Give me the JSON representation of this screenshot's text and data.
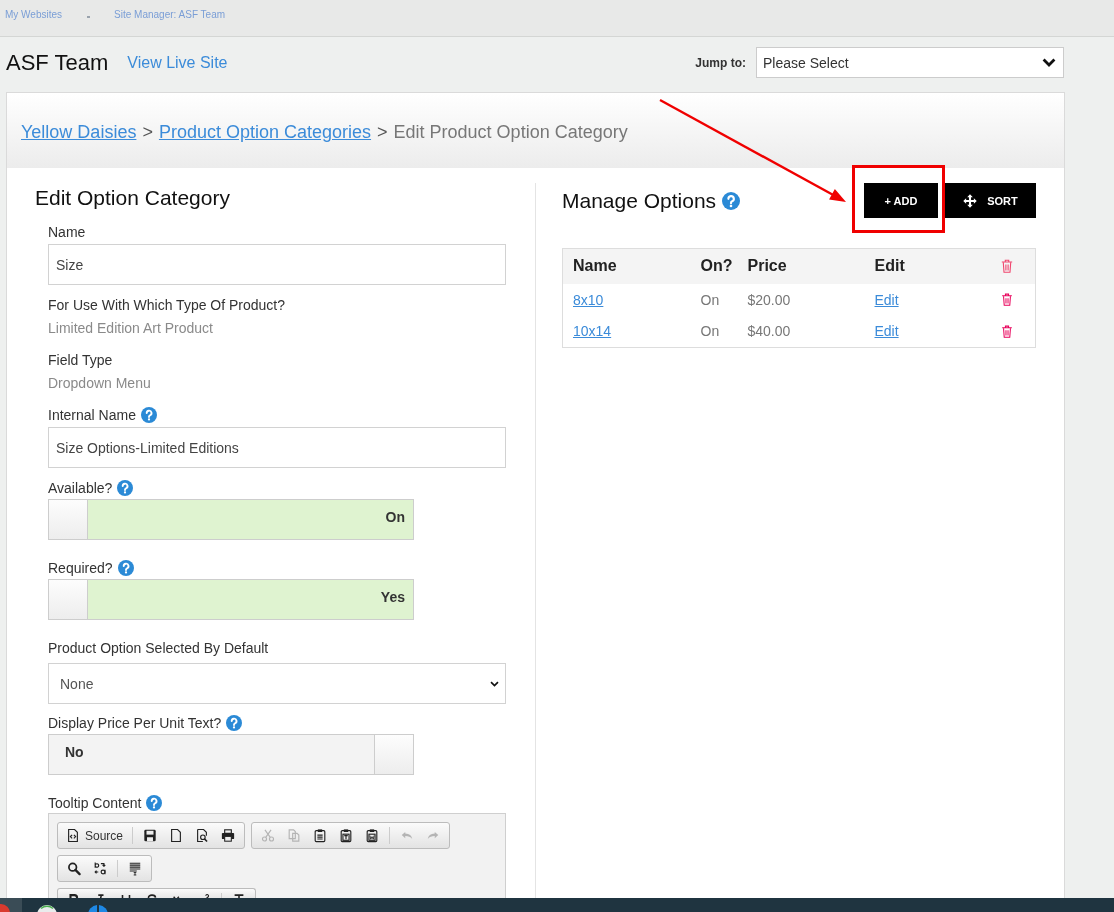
{
  "top_nav": {
    "links": [
      {
        "label": "My Websites"
      },
      {
        "label": "Site Manager: ASF Team"
      }
    ]
  },
  "header": {
    "title": "ASF Team",
    "view_link": "View Live Site",
    "jump_to": {
      "label": "Jump to:",
      "value": "Please Select"
    }
  },
  "breadcrumb": [
    {
      "kind": "link",
      "label": "Yellow Daisies"
    },
    {
      "kind": "separator",
      "label": ">"
    },
    {
      "kind": "link",
      "label": "Product Option Categories"
    },
    {
      "kind": "separator",
      "label": ">"
    },
    {
      "kind": "current",
      "label": "Edit Product Option Category"
    }
  ],
  "edit_form": {
    "title": "Edit Option Category",
    "fields": [
      {
        "kind": "text",
        "label": "Name",
        "help": false,
        "value": "Size"
      },
      {
        "kind": "static",
        "label": "For Use With Which Type Of Product?",
        "help": false,
        "value": "Limited Edition Art Product"
      },
      {
        "kind": "static",
        "label": "Field Type",
        "help": false,
        "value": "Dropdown Menu"
      },
      {
        "kind": "text",
        "label": "Internal Name",
        "help": true,
        "value": "Size Options-Limited Editions"
      },
      {
        "kind": "toggle",
        "label": "Available?",
        "help": true,
        "on": true,
        "value": "On"
      },
      {
        "kind": "toggle",
        "label": "Required?",
        "help": true,
        "on": true,
        "value": "Yes"
      },
      {
        "kind": "select",
        "label": "Product Option Selected By Default",
        "help": false,
        "value": "None"
      },
      {
        "kind": "toggle",
        "label": "Display Price Per Unit Text?",
        "help": true,
        "on": false,
        "value": "No"
      },
      {
        "kind": "editor",
        "label": "Tooltip Content",
        "help": true,
        "toolbar_rows": [
          {
            "groups": [
              {
                "sections": [
                  [
                    {
                      "kind": "source",
                      "label": "Source",
                      "disabled": false
                    }
                  ],
                  [
                    {
                      "kind": "save",
                      "disabled": false
                    },
                    {
                      "kind": "newpage",
                      "disabled": false
                    },
                    {
                      "kind": "preview",
                      "disabled": false
                    },
                    {
                      "kind": "print",
                      "disabled": false
                    }
                  ]
                ]
              },
              {
                "sections": [
                  [
                    {
                      "kind": "cut",
                      "disabled": true
                    },
                    {
                      "kind": "copy",
                      "disabled": true
                    },
                    {
                      "kind": "paste",
                      "disabled": false
                    },
                    {
                      "kind": "pastetext",
                      "disabled": false
                    },
                    {
                      "kind": "pasteword",
                      "disabled": false
                    }
                  ],
                  [
                    {
                      "kind": "undo",
                      "disabled": true
                    },
                    {
                      "kind": "redo",
                      "disabled": true
                    }
                  ]
                ]
              }
            ]
          },
          {
            "groups": [
              {
                "sections": [
                  [
                    {
                      "kind": "find",
                      "disabled": false
                    },
                    {
                      "kind": "replace",
                      "disabled": false
                    }
                  ],
                  [
                    {
                      "kind": "selectall",
                      "disabled": false
                    }
                  ]
                ]
              }
            ]
          },
          {
            "groups": [
              {
                "sections": [
                  [
                    {
                      "kind": "bold",
                      "disabled": false
                    },
                    {
                      "kind": "italic",
                      "disabled": false
                    },
                    {
                      "kind": "underline",
                      "disabled": false
                    },
                    {
                      "kind": "strike",
                      "disabled": false
                    },
                    {
                      "kind": "subscript",
                      "disabled": false
                    },
                    {
                      "kind": "superscript",
                      "disabled": false
                    }
                  ],
                  [
                    {
                      "kind": "removeformat",
                      "disabled": false
                    }
                  ]
                ]
              }
            ]
          }
        ]
      }
    ]
  },
  "manage_options": {
    "title": "Manage Options",
    "help": true,
    "buttons": [
      {
        "kind": "add",
        "label": "+ ADD"
      },
      {
        "kind": "sort",
        "label": "SORT"
      }
    ],
    "table": {
      "columns": [
        {
          "kind": "text",
          "label": "Name"
        },
        {
          "kind": "text",
          "label": "On?"
        },
        {
          "kind": "text",
          "label": "Price"
        },
        {
          "kind": "text",
          "label": "Edit"
        },
        {
          "kind": "delete"
        }
      ],
      "rows": [
        {
          "name": "8x10",
          "on": "On",
          "price": "$20.00",
          "edit": "Edit"
        },
        {
          "name": "10x14",
          "on": "On",
          "price": "$40.00",
          "edit": "Edit"
        }
      ]
    }
  },
  "annotations": {
    "arrow": true,
    "box": true
  }
}
